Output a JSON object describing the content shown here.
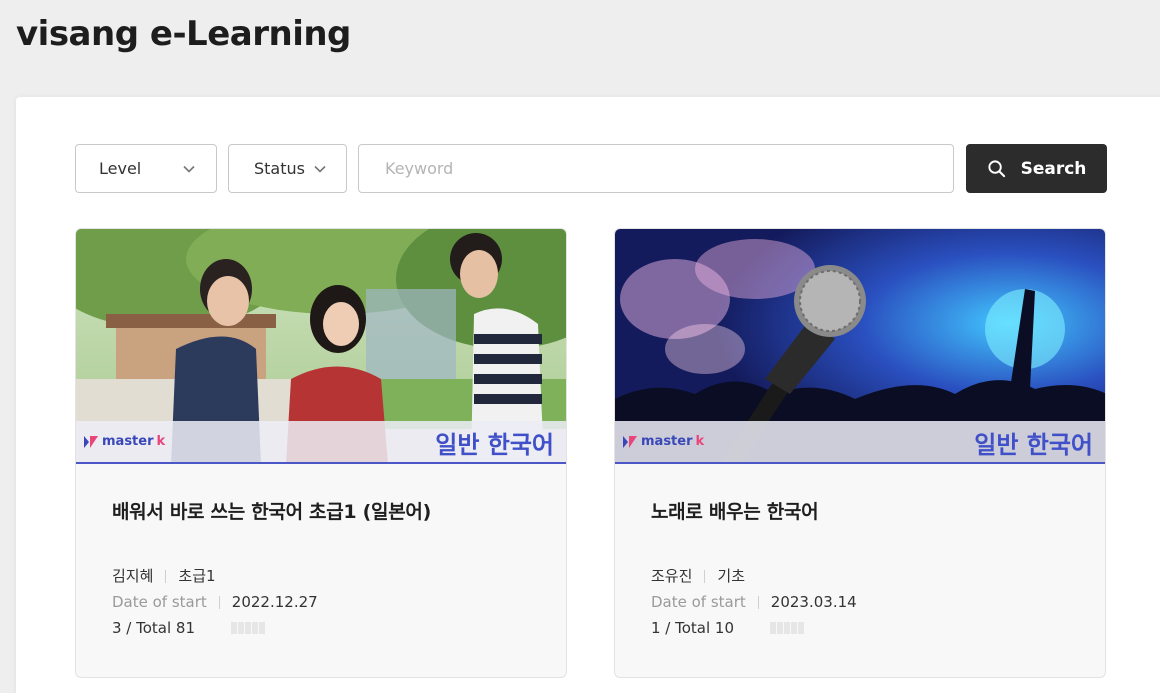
{
  "app": {
    "title": "visang e-Learning"
  },
  "filters": {
    "level_label": "Level",
    "status_label": "Status",
    "keyword_placeholder": "Keyword",
    "keyword_value": "",
    "search_label": "Search"
  },
  "colors": {
    "accent": "#4050c9",
    "button_bg": "#2c2c2c",
    "brand_k": "#e8457a"
  },
  "courses": [
    {
      "brand": "master",
      "brand_k": "k",
      "category": "일반 한국어",
      "title": "배워서 바로 쓰는 한국어 초급1 (일본어)",
      "instructor": "김지혜",
      "level": "초급1",
      "date_label": "Date of start",
      "date": "2022.12.27",
      "progress_text": "3 / Total 81",
      "progress": 0.037,
      "image_icon": "students-photo"
    },
    {
      "brand": "master",
      "brand_k": "k",
      "category": "일반 한국어",
      "title": "노래로 배우는 한국어",
      "instructor": "조유진",
      "level": "기초",
      "date_label": "Date of start",
      "date": "2023.03.14",
      "progress_text": "1 / Total 10",
      "progress": 0.1,
      "image_icon": "microphone-concert-photo"
    }
  ]
}
